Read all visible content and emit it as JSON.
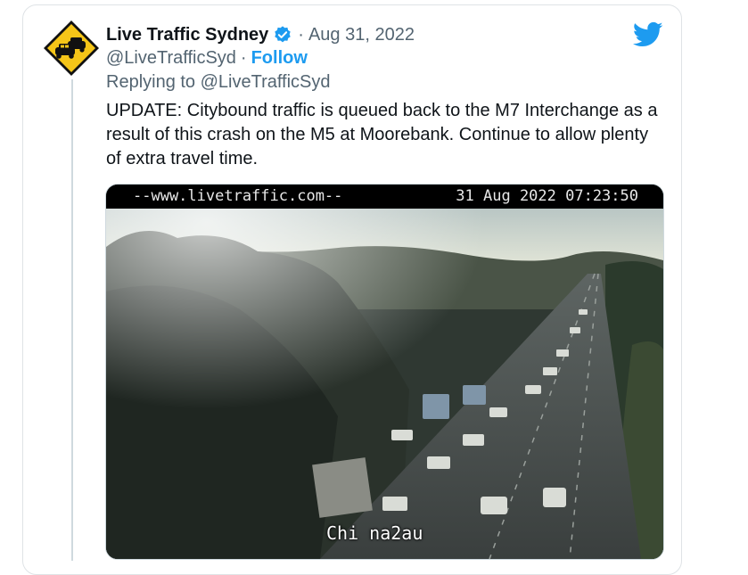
{
  "tweet": {
    "display_name": "Live Traffic Sydney",
    "separator": "·",
    "date": "Aug 31, 2022",
    "handle": "@LiveTrafficSyd",
    "handle_separator": "·",
    "follow_label": "Follow",
    "replying_to": "Replying to @LiveTrafficSyd",
    "text": "UPDATE: Citybound traffic is queued back to the M7 Interchange as a result of this crash on the M5 at Moorebank. Continue to allow plenty of extra travel time."
  },
  "media": {
    "camera_url": "--www.livetraffic.com--",
    "camera_timestamp": "31 Aug 2022 07:23:50"
  },
  "watermark": "Chi na2au",
  "colors": {
    "twitter_blue": "#1d9bf0",
    "text_primary": "#0f1419",
    "text_secondary": "#536471",
    "avatar_sign_yellow": "#f5c518"
  },
  "icons": {
    "avatar": "traffic-warning-sign-icon",
    "verified": "verified-badge-icon",
    "logo": "twitter-bird-icon"
  }
}
